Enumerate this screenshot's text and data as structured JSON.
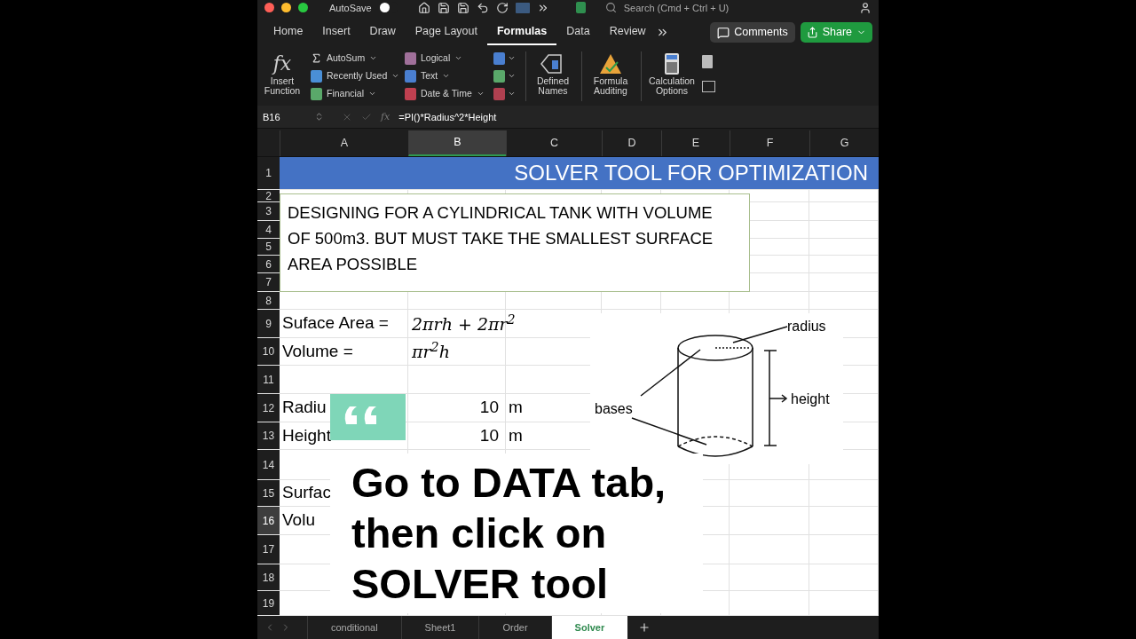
{
  "title_bar": {
    "autosave": {
      "label": "AutoSave",
      "on": false
    },
    "search": {
      "placeholder": "Search (Cmd + Ctrl + U)"
    }
  },
  "ribbon_tabs": [
    {
      "label": "Home",
      "selected": false
    },
    {
      "label": "Insert",
      "selected": false
    },
    {
      "label": "Draw",
      "selected": false
    },
    {
      "label": "Page Layout",
      "selected": false
    },
    {
      "label": "Formulas",
      "selected": true
    },
    {
      "label": "Data",
      "selected": false
    },
    {
      "label": "Review",
      "selected": false
    }
  ],
  "ribbon_buttons": {
    "comments": "Comments",
    "share": "Share"
  },
  "ribbon": {
    "insert_function_symbol": "fx",
    "insert_function": "Insert\nFunction",
    "column_1": [
      {
        "label": "AutoSum"
      },
      {
        "label": "Recently Used",
        "color": "#4a8fd6"
      },
      {
        "label": "Financial",
        "color": "#5aa86a"
      }
    ],
    "column_2": [
      {
        "label": "Logical",
        "color": "#a0709a"
      },
      {
        "label": "Text",
        "color": "#4a7fd0"
      },
      {
        "label": "Date & Time",
        "color": "#c04050"
      }
    ],
    "column_3": [
      {
        "color": "#4a7fd0"
      },
      {
        "color": "#5aa86a"
      },
      {
        "color": "#b04050"
      }
    ],
    "defined_names": "Defined\nNames",
    "formula_auditing": "Formula\nAuditing",
    "calculation_options": "Calculation\nOptions"
  },
  "formula_bar": {
    "name_box": "B16",
    "function_symbol": "fx",
    "formula": "=PI()*Radius^2*Height"
  },
  "columns": [
    {
      "label": "A",
      "selected": false
    },
    {
      "label": "B",
      "selected": true
    },
    {
      "label": "C",
      "selected": false
    },
    {
      "label": "D",
      "selected": false
    },
    {
      "label": "E",
      "selected": false
    },
    {
      "label": "F",
      "selected": false
    },
    {
      "label": "G",
      "selected": false
    }
  ],
  "rows": [
    {
      "label": "1",
      "selected": false
    },
    {
      "label": "2",
      "selected": false
    },
    {
      "label": "3",
      "selected": false
    },
    {
      "label": "4",
      "selected": false
    },
    {
      "label": "5",
      "selected": false
    },
    {
      "label": "6",
      "selected": false
    },
    {
      "label": "7",
      "selected": false
    },
    {
      "label": "8",
      "selected": false
    },
    {
      "label": "9",
      "selected": false,
      "cells": {
        "a": {
          "text": "Suface Area =",
          "kind": "label"
        },
        "b": {
          "text": "2πrh + 2πr$^{2}$",
          "kind": "math"
        }
      }
    },
    {
      "label": "10",
      "selected": false,
      "cells": {
        "a": {
          "text": "Volume =",
          "kind": "label"
        },
        "b": {
          "text": "πr$^{2}$h",
          "kind": "math"
        }
      }
    },
    {
      "label": "11",
      "selected": false
    },
    {
      "label": "12",
      "selected": false,
      "cells": {
        "a": {
          "text": "Radiu",
          "kind": "label"
        },
        "b": {
          "text": "10",
          "kind": "number"
        },
        "c": {
          "text": "m",
          "kind": "label"
        }
      }
    },
    {
      "label": "13",
      "selected": false,
      "cells": {
        "a": {
          "text": "Height",
          "kind": "label"
        },
        "b": {
          "text": "10",
          "kind": "number"
        },
        "c": {
          "text": "m",
          "kind": "label"
        }
      }
    },
    {
      "label": "14",
      "selected": false
    },
    {
      "label": "15",
      "selected": false,
      "cells": {
        "a": {
          "text": "Surfac",
          "kind": "label"
        }
      }
    },
    {
      "label": "16",
      "selected": true,
      "cells": {
        "a": {
          "text": "Volu",
          "kind": "label"
        }
      }
    },
    {
      "label": "17",
      "selected": false
    },
    {
      "label": "18",
      "selected": false
    },
    {
      "label": "19",
      "selected": false
    }
  ],
  "banner": "SOLVER TOOL FOR OPTIMIZATION",
  "text_box": "DESIGNING FOR A CYLINDRICAL TANK WITH VOLUME OF 500m3. BUT MUST TAKE THE SMALLEST SURFACE AREA POSSIBLE",
  "diagram": {
    "radius": "radius",
    "height": "height",
    "bases": "bases"
  },
  "caption": [
    "Go to DATA tab,",
    "then click on",
    "SOLVER tool"
  ],
  "sheet_tabs": [
    {
      "label": "conditional",
      "selected": false
    },
    {
      "label": "Sheet1",
      "selected": false
    },
    {
      "label": "Order",
      "selected": false
    },
    {
      "label": "Solver",
      "selected": true
    }
  ]
}
